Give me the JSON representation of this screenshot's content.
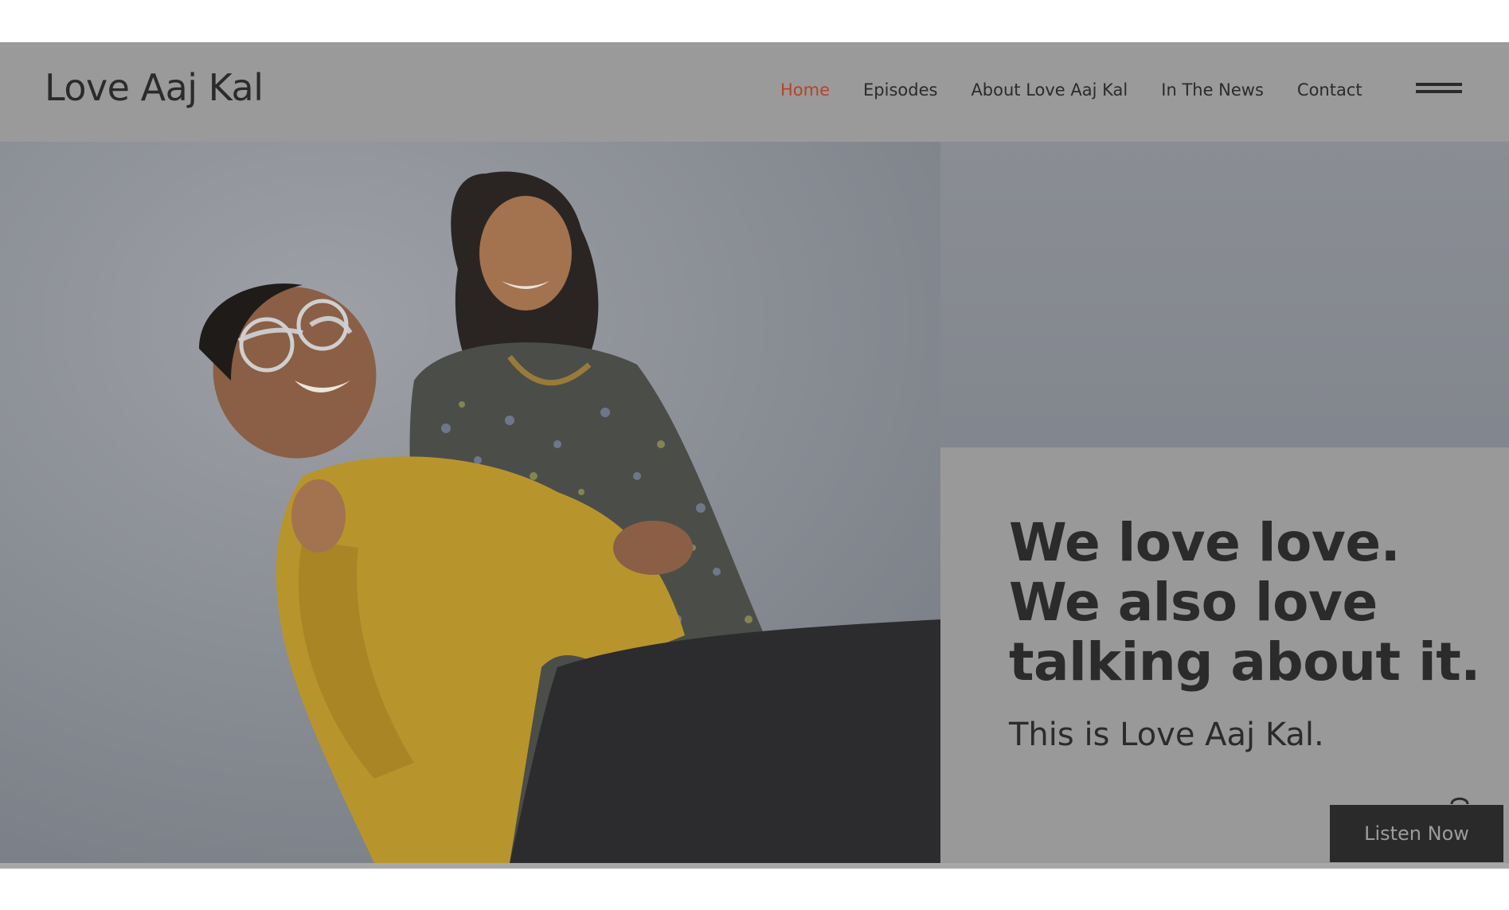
{
  "header": {
    "logo": "Love Aaj Kal",
    "nav": [
      {
        "label": "Home",
        "active": true
      },
      {
        "label": "Episodes",
        "active": false
      },
      {
        "label": "About Love Aaj Kal",
        "active": false
      },
      {
        "label": "In The News",
        "active": false
      },
      {
        "label": "Contact",
        "active": false
      }
    ],
    "menu_icon": "hamburger-icon"
  },
  "hero": {
    "headline": [
      "We love love.",
      "We also love",
      "talking about it."
    ],
    "subline": "This is Love Aaj Kal.",
    "listen_label": "Listen Now"
  },
  "colors": {
    "overlay": "#9a9a9a",
    "text": "#2b2b2b",
    "active_nav": "#b5442a",
    "button_bg": "#2a2a2a",
    "button_text": "#9c9c9c",
    "shirt_mustard": "#b8952c"
  }
}
